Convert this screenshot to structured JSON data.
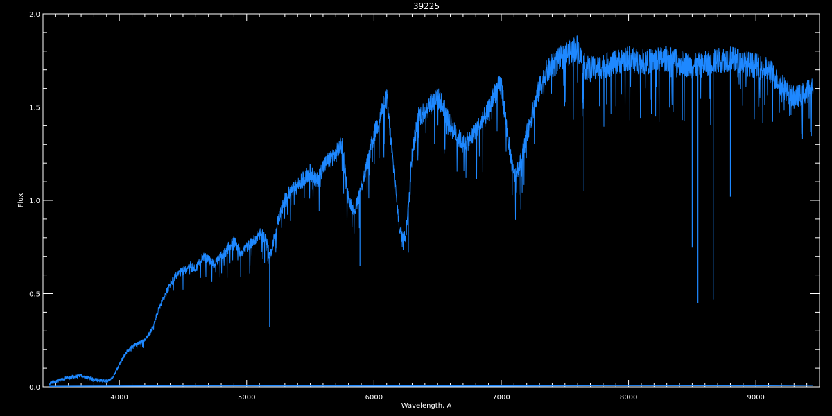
{
  "chart_data": {
    "type": "line",
    "title": "39225",
    "xlabel": "Wavelength, A",
    "ylabel": "Flux",
    "xlim": [
      3400,
      9500
    ],
    "ylim": [
      0.0,
      2.0
    ],
    "x_ticks": [
      4000,
      5000,
      6000,
      7000,
      8000,
      9000
    ],
    "x_tick_labels": [
      "4000",
      "5000",
      "6000",
      "7000",
      "8000",
      "9000"
    ],
    "y_ticks": [
      0.0,
      0.5,
      1.0,
      1.5,
      2.0
    ],
    "y_tick_labels": [
      "0.0",
      "0.5",
      "1.0",
      "1.5",
      "2.0"
    ],
    "grid": false,
    "colors": {
      "spectrum": "#1e88ff",
      "axes": "#ffffff",
      "background": "#000000"
    },
    "series": [
      {
        "values_x": [
          3450,
          3500,
          3600,
          3700,
          3800,
          3900,
          3950,
          4000,
          4050,
          4100,
          4200,
          4250,
          4300,
          4350,
          4400,
          4450,
          4500,
          4550,
          4600,
          4650,
          4700,
          4750,
          4800,
          4850,
          4900,
          4950,
          5000,
          5050,
          5100,
          5150,
          5180,
          5200,
          5250,
          5300,
          5350,
          5400,
          5450,
          5500,
          5550,
          5600,
          5650,
          5700,
          5750,
          5800,
          5850,
          5890,
          5950,
          6000,
          6050,
          6100,
          6150,
          6200,
          6250,
          6300,
          6350,
          6400,
          6450,
          6500,
          6550,
          6600,
          6650,
          6700,
          6750,
          6800,
          6850,
          6900,
          6950,
          7000,
          7050,
          7100,
          7150,
          7200,
          7250,
          7300,
          7350,
          7400,
          7450,
          7500,
          7550,
          7600,
          7650,
          7700,
          7800,
          7900,
          8000,
          8100,
          8200,
          8300,
          8400,
          8500,
          8600,
          8700,
          8800,
          8900,
          9000,
          9100,
          9200,
          9300,
          9400,
          9450
        ],
        "values_y": [
          0.02,
          0.03,
          0.05,
          0.06,
          0.04,
          0.03,
          0.05,
          0.12,
          0.18,
          0.22,
          0.25,
          0.3,
          0.4,
          0.48,
          0.55,
          0.6,
          0.62,
          0.65,
          0.63,
          0.7,
          0.68,
          0.66,
          0.7,
          0.74,
          0.78,
          0.72,
          0.75,
          0.78,
          0.82,
          0.8,
          0.7,
          0.75,
          0.9,
          1.0,
          1.05,
          1.08,
          1.12,
          1.15,
          1.1,
          1.18,
          1.22,
          1.25,
          1.3,
          1.0,
          0.95,
          1.05,
          1.2,
          1.35,
          1.45,
          1.55,
          1.2,
          0.85,
          0.8,
          1.25,
          1.45,
          1.48,
          1.52,
          1.55,
          1.5,
          1.4,
          1.35,
          1.3,
          1.32,
          1.38,
          1.42,
          1.48,
          1.58,
          1.62,
          1.35,
          1.12,
          1.2,
          1.35,
          1.48,
          1.6,
          1.68,
          1.72,
          1.75,
          1.78,
          1.8,
          1.82,
          1.72,
          1.7,
          1.72,
          1.74,
          1.76,
          1.74,
          1.75,
          1.76,
          1.74,
          1.72,
          1.73,
          1.75,
          1.76,
          1.74,
          1.72,
          1.7,
          1.62,
          1.55,
          1.58,
          1.62
        ],
        "absorption_lines": [
          {
            "x": 5180,
            "y": 0.32
          },
          {
            "x": 5890,
            "y": 0.65
          },
          {
            "x": 6270,
            "y": 0.72
          },
          {
            "x": 7650,
            "y": 1.05
          },
          {
            "x": 8500,
            "y": 0.75
          },
          {
            "x": 8545,
            "y": 0.45
          },
          {
            "x": 8665,
            "y": 0.47
          },
          {
            "x": 8800,
            "y": 1.02
          }
        ]
      },
      {
        "values_x": [
          3450,
          4000,
          5000,
          6000,
          7000,
          8000,
          9000,
          9450
        ],
        "values_y": [
          0.003,
          0.004,
          0.006,
          0.005,
          0.005,
          0.007,
          0.006,
          0.008
        ]
      }
    ]
  }
}
